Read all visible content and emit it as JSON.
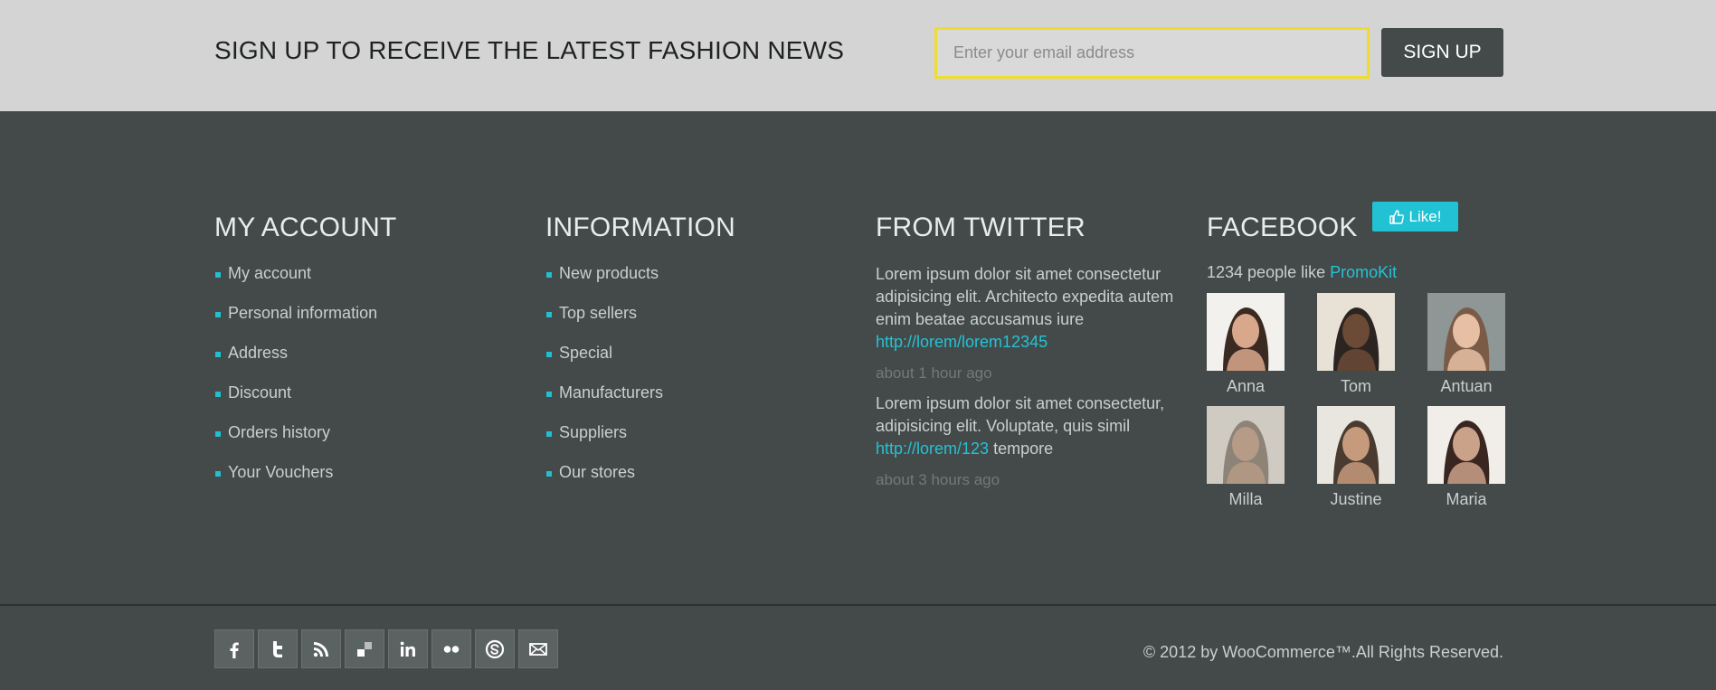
{
  "newsletter": {
    "title": "SIGN UP TO RECEIVE THE LATEST FASHION NEWS",
    "email_placeholder": "Enter your email address",
    "signup_label": "SIGN UP"
  },
  "my_account": {
    "heading": "MY ACCOUNT",
    "items": [
      "My account",
      "Personal information",
      "Address",
      "Discount",
      "Orders history",
      "Your Vouchers"
    ]
  },
  "information": {
    "heading": "INFORMATION",
    "items": [
      "New products",
      "Top sellers",
      "Special",
      "Manufacturers",
      "Suppliers",
      "Our stores"
    ]
  },
  "twitter": {
    "heading": "FROM TWITTER",
    "tweets": [
      {
        "text": "Lorem ipsum dolor sit amet consectetur adipisicing elit. Architecto expedita autem enim beatae accusamus iure",
        "link": "http://lorem/lorem12345",
        "after": "",
        "time": "about 1 hour ago"
      },
      {
        "text": "Lorem ipsum dolor sit amet consectetur, adipisicing elit. Voluptate, quis simil",
        "link": "http://lorem/123",
        "after": " tempore",
        "time": "about 3 hours ago"
      }
    ]
  },
  "facebook": {
    "heading": "FACEBOOK",
    "like_label": "Like!",
    "likes_prefix": "1234 people like ",
    "likes_link": "PromoKit",
    "friends": [
      {
        "name": "Anna",
        "tones": [
          "#f3f1ee",
          "#3a2a22",
          "#d9a88c"
        ]
      },
      {
        "name": "Tom",
        "tones": [
          "#e8e2d6",
          "#2b2421",
          "#6b4a36"
        ]
      },
      {
        "name": "Antuan",
        "tones": [
          "#8e9696",
          "#7a5c46",
          "#e6bfa4"
        ]
      },
      {
        "name": "Milla",
        "tones": [
          "#cfcac2",
          "#8d8377",
          "#b69b86"
        ]
      },
      {
        "name": "Justine",
        "tones": [
          "#e9e6df",
          "#4a3b30",
          "#c69a7c"
        ]
      },
      {
        "name": "Maria",
        "tones": [
          "#f1ede8",
          "#3a2620",
          "#caa189"
        ]
      }
    ]
  },
  "footer": {
    "socials": [
      "facebook-icon",
      "twitter-icon",
      "rss-icon",
      "delicious-icon",
      "linkedin-icon",
      "flickr-icon",
      "skype-icon",
      "email-icon"
    ],
    "copyright": "© 2012 by WooCommerce™.All Rights Reserved."
  },
  "colors": {
    "accent": "#21bfd0",
    "background": "#434a49",
    "newsletter_bg": "#d4d4d4",
    "input_border": "#f0dc2e"
  }
}
